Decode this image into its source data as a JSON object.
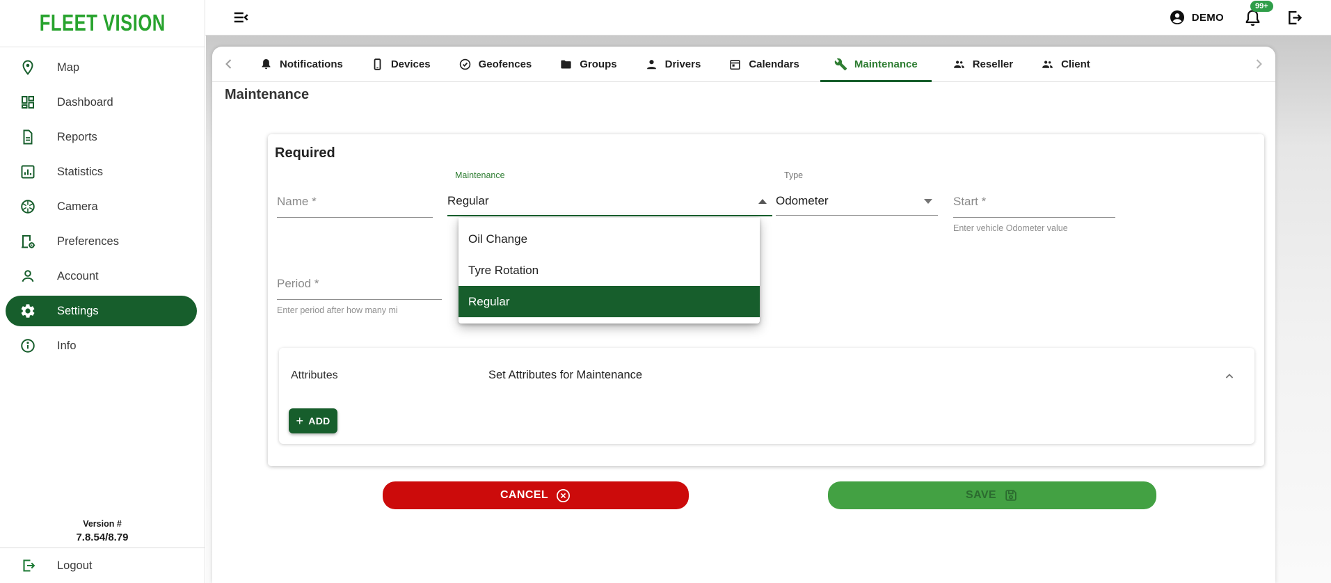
{
  "brand": {
    "name": "FLEET VISION"
  },
  "topbar": {
    "user_label": "DEMO",
    "badge": "99+",
    "icons": [
      "menu-collapse-icon",
      "account-circle-icon",
      "notification-bell-icon",
      "logout-icon"
    ]
  },
  "sidebar": {
    "items": [
      {
        "label": "Map",
        "icon": "map-pin-icon"
      },
      {
        "label": "Dashboard",
        "icon": "dashboard-grid-icon"
      },
      {
        "label": "Reports",
        "icon": "report-document-icon"
      },
      {
        "label": "Statistics",
        "icon": "statistics-chart-icon"
      },
      {
        "label": "Camera",
        "icon": "camera-aperture-icon"
      },
      {
        "label": "Preferences",
        "icon": "preferences-icon"
      },
      {
        "label": "Account",
        "icon": "person-icon"
      },
      {
        "label": "Settings",
        "icon": "gear-icon",
        "active": true
      },
      {
        "label": "Info",
        "icon": "info-icon"
      }
    ]
  },
  "sidebar_footer": {
    "version_label": "Version #",
    "version_value": "7.8.54/8.79",
    "logout": "Logout",
    "logout_icon": "exit-icon"
  },
  "tabs": {
    "items": [
      {
        "label": "Notifications",
        "icon": "bell-icon"
      },
      {
        "label": "Devices",
        "icon": "smartphone-icon"
      },
      {
        "label": "Geofences",
        "icon": "circle-check-icon"
      },
      {
        "label": "Groups",
        "icon": "folder-icon"
      },
      {
        "label": "Drivers",
        "icon": "person-icon"
      },
      {
        "label": "Calendars",
        "icon": "calendar-icon"
      },
      {
        "label": "Maintenance",
        "icon": "wrench-icon",
        "active": true
      },
      {
        "label": "Reseller",
        "icon": "people-icon"
      },
      {
        "label": "Client",
        "icon": "people-icon"
      }
    ],
    "active": "Maintenance"
  },
  "page": {
    "title": "Maintenance"
  },
  "required_section": {
    "title": "Required",
    "name_placeholder": "Name *",
    "maintenance_label": "Maintenance",
    "maintenance_value": "Regular",
    "type_label": "Type",
    "type_value": "Odometer",
    "start_placeholder": "Start *",
    "start_hint": "Enter vehicle Odometer value",
    "period_placeholder": "Period *",
    "period_hint": "Enter period after how many mi",
    "dropdown_options": [
      "Oil Change",
      "Tyre Rotation",
      "Regular"
    ],
    "dropdown_selected": "Regular"
  },
  "attributes_panel": {
    "title": "Attributes",
    "description": "Set Attributes for Maintenance",
    "add_button": "ADD",
    "collapse_icon": "chevron-up-icon"
  },
  "actions": {
    "cancel": "CANCEL",
    "save": "SAVE"
  },
  "colors": {
    "primary_dark_green": "#175e2c",
    "tab_active_green": "#2e7d32",
    "logo_green": "#28a32e",
    "badge_green": "#2f9e49",
    "cancel_red": "#cc0b0b",
    "save_green": "#43a143"
  }
}
